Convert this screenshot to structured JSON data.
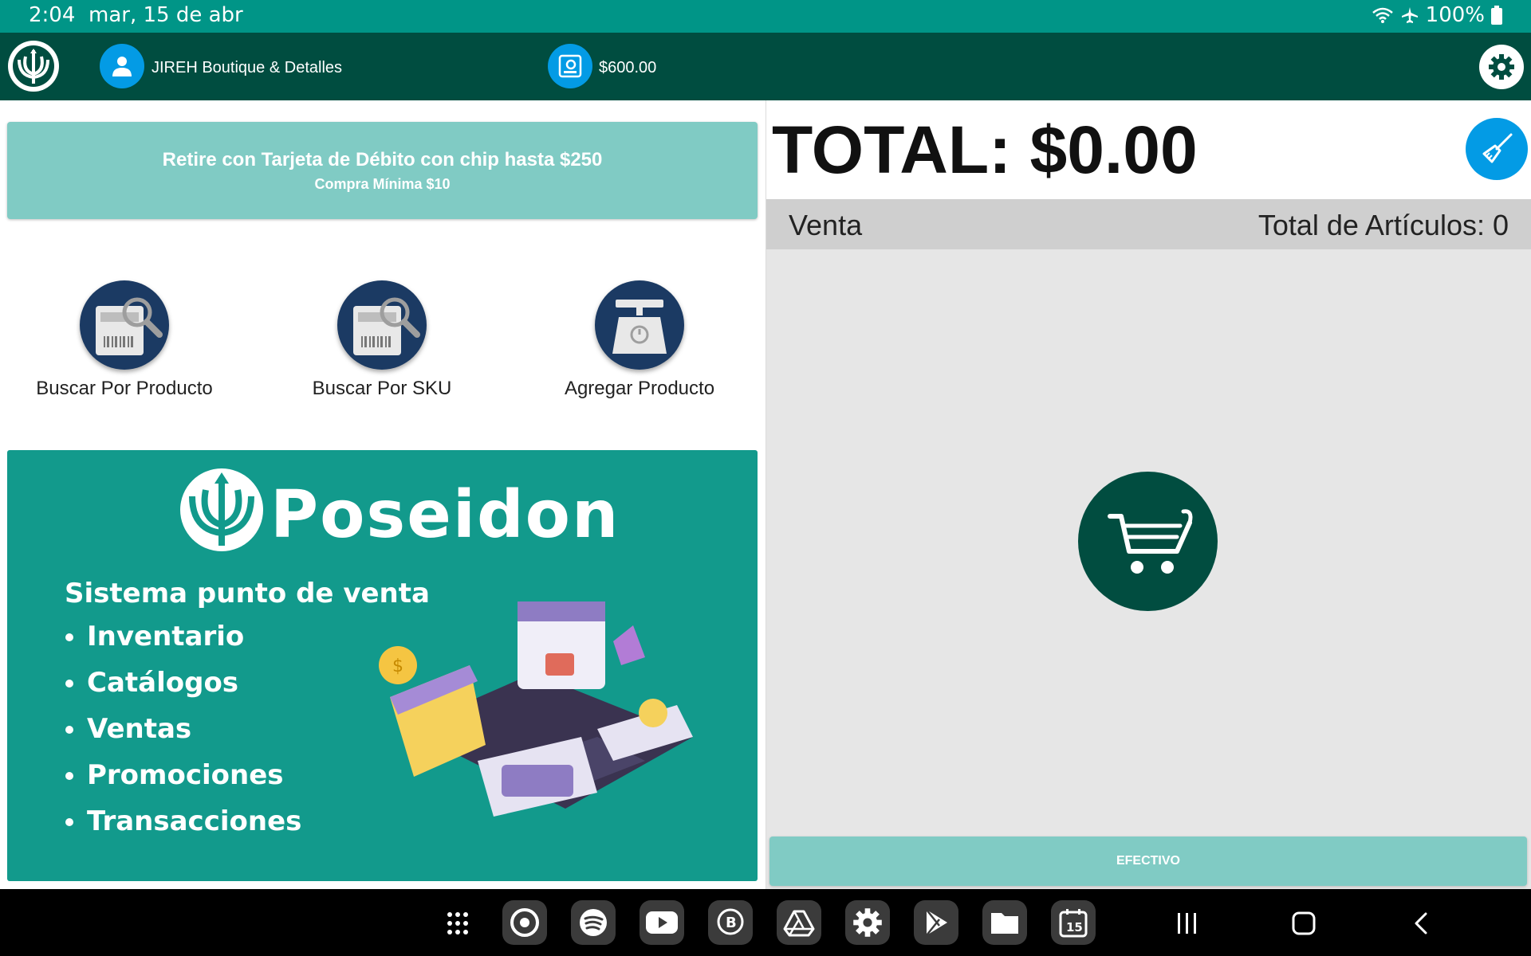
{
  "status_bar": {
    "time": "2:04",
    "date": "mar, 15 de abr",
    "battery": "100%",
    "icons": [
      "wifi-icon",
      "airplane-icon",
      "battery-icon"
    ]
  },
  "app_bar": {
    "logo_icon": "trident-logo-icon",
    "store_name": "JIREH Boutique & Detalles",
    "cash_amount": "$600.00",
    "settings_icon": "gear-icon"
  },
  "promo": {
    "line1": "Retire con Tarjeta de Débito con chip hasta $250",
    "line2": "Compra Mínima $10"
  },
  "actions": [
    {
      "label": "Buscar Por Producto",
      "icon": "search-product-icon"
    },
    {
      "label": "Buscar Por SKU",
      "icon": "search-sku-icon"
    },
    {
      "label": "Agregar Producto",
      "icon": "scale-icon"
    }
  ],
  "banner": {
    "brand": "Poseidon",
    "subtitle": "Sistema punto de venta",
    "items": [
      "Inventario",
      "Catálogos",
      "Ventas",
      "Promociones",
      "Transacciones"
    ]
  },
  "sale": {
    "total": "TOTAL: $0.00",
    "mode": "Venta",
    "items_count": "Total de Artículos: 0",
    "pay_button": "EFECTIVO"
  },
  "colors": {
    "status_bar": "#009587",
    "app_bar": "#004d40",
    "promo": "#80cbc4",
    "action_icon": "#1b3a63",
    "banner": "#129a8c",
    "cart": "#014d40",
    "clear_button": "#039be5"
  },
  "dock": [
    "apps-icon",
    "chrome-icon",
    "spotify-icon",
    "youtube-icon",
    "whatsapp-business-icon",
    "drive-icon",
    "settings-icon",
    "play-store-icon",
    "files-icon",
    "calendar-icon"
  ],
  "calendar_day": "15"
}
